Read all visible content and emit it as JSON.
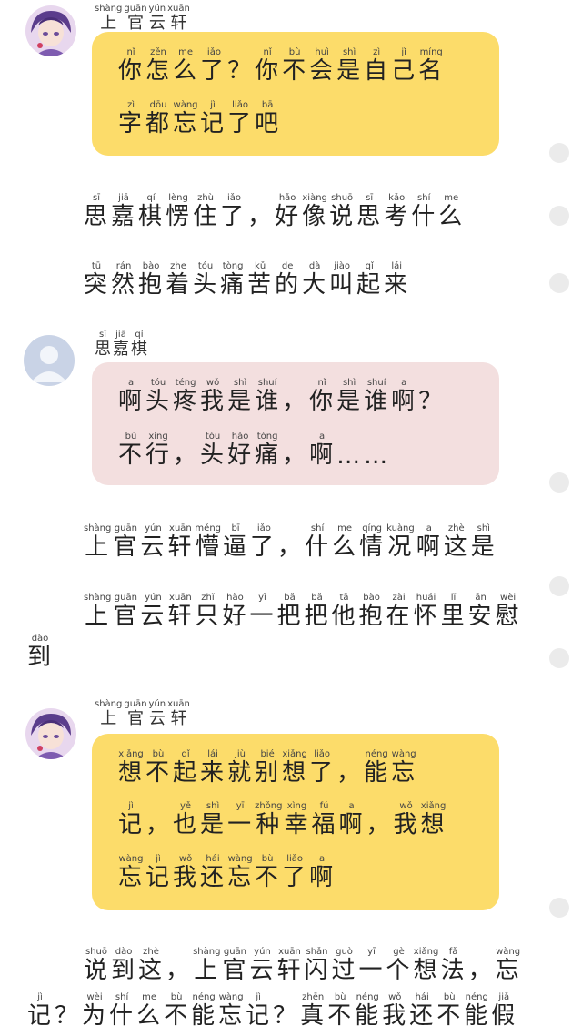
{
  "characters": {
    "shangguan": {
      "name": "上官云轩",
      "pinyin": [
        "shàng",
        "guān",
        "yún",
        "xuān"
      ]
    },
    "siqi": {
      "name": "思嘉棋",
      "pinyin": [
        "sī",
        "jiā",
        "qí"
      ]
    }
  },
  "messages": [
    {
      "type": "bubble",
      "speaker": "shangguan",
      "color": "yellow",
      "lines": [
        {
          "text": "你怎么了？你不会是自己名",
          "pinyin": [
            "nǐ",
            "zěn",
            "me",
            "liǎo",
            "",
            "nǐ",
            "bù",
            "huì",
            "shì",
            "zì",
            "jǐ",
            "míng"
          ]
        },
        {
          "text": "字都忘记了吧",
          "pinyin": [
            "zì",
            "dōu",
            "wàng",
            "jì",
            "liǎo",
            "bā"
          ]
        }
      ]
    },
    {
      "type": "narration",
      "lines": [
        {
          "text": "思嘉棋愣住了，好像说思考什么",
          "pinyin": [
            "sī",
            "jiā",
            "qí",
            "lèng",
            "zhù",
            "liǎo",
            "",
            "hǎo",
            "xiàng",
            "shuō",
            "sī",
            "kǎo",
            "shí",
            "me"
          ]
        }
      ]
    },
    {
      "type": "narration",
      "lines": [
        {
          "text": "突然抱着头痛苦的大叫起来",
          "pinyin": [
            "tū",
            "rán",
            "bào",
            "zhe",
            "tóu",
            "tòng",
            "kǔ",
            "de",
            "dà",
            "jiào",
            "qǐ",
            "lái"
          ]
        }
      ]
    },
    {
      "type": "bubble",
      "speaker": "siqi",
      "color": "pink",
      "lines": [
        {
          "text": "啊头疼我是谁，你是谁啊？",
          "pinyin": [
            "a",
            "tóu",
            "téng",
            "wǒ",
            "shì",
            "shuí",
            "",
            "nǐ",
            "shì",
            "shuí",
            "a",
            ""
          ]
        },
        {
          "text": "不行，头好痛，啊……",
          "pinyin": [
            "bù",
            "xíng",
            "",
            "tóu",
            "hǎo",
            "tòng",
            "",
            "a",
            "",
            ""
          ]
        }
      ]
    },
    {
      "type": "narration",
      "lines": [
        {
          "text": "上官云轩懵逼了，什么情况啊这是",
          "pinyin": [
            "shàng",
            "guān",
            "yún",
            "xuān",
            "měng",
            "bī",
            "liǎo",
            "",
            "shí",
            "me",
            "qíng",
            "kuàng",
            "a",
            "zhè",
            "shì"
          ]
        }
      ]
    },
    {
      "type": "narration",
      "lines": [
        {
          "text": "上官云轩只好一把把他抱在怀里安慰",
          "pinyin": [
            "shàng",
            "guān",
            "yún",
            "xuān",
            "zhǐ",
            "hǎo",
            "yī",
            "bǎ",
            "bǎ",
            "tā",
            "bào",
            "zài",
            "huái",
            "lǐ",
            "ān",
            "wèi"
          ]
        },
        {
          "text": "到",
          "pinyin": [
            "dào"
          ]
        }
      ]
    },
    {
      "type": "bubble",
      "speaker": "shangguan",
      "color": "yellow",
      "lines": [
        {
          "text": "想不起来就别想了，能忘",
          "pinyin": [
            "xiǎng",
            "bù",
            "qǐ",
            "lái",
            "jiù",
            "bié",
            "xiǎng",
            "liǎo",
            "",
            "néng",
            "wàng"
          ]
        },
        {
          "text": "记，也是一种幸福啊，我想",
          "pinyin": [
            "jì",
            "",
            "yě",
            "shì",
            "yī",
            "zhǒng",
            "xìng",
            "fú",
            "a",
            "",
            "wǒ",
            "xiǎng"
          ]
        },
        {
          "text": "忘记我还忘不了啊",
          "pinyin": [
            "wàng",
            "jì",
            "wǒ",
            "hái",
            "wàng",
            "bù",
            "liǎo",
            "a"
          ]
        }
      ]
    },
    {
      "type": "narration",
      "lines": [
        {
          "text": "说到这，上官云轩闪过一个想法，忘",
          "pinyin": [
            "shuō",
            "dào",
            "zhè",
            "",
            "shàng",
            "guān",
            "yún",
            "xuān",
            "shǎn",
            "guò",
            "yī",
            "gè",
            "xiǎng",
            "fǎ",
            "",
            "wàng"
          ]
        },
        {
          "text": "记？为什么不能忘记？真不能我还不能假",
          "pinyin": [
            "jì",
            "",
            "wèi",
            "shí",
            "me",
            "bù",
            "néng",
            "wàng",
            "jì",
            "",
            "zhēn",
            "bù",
            "néng",
            "wǒ",
            "hái",
            "bù",
            "néng",
            "jiǎ"
          ]
        }
      ]
    }
  ]
}
